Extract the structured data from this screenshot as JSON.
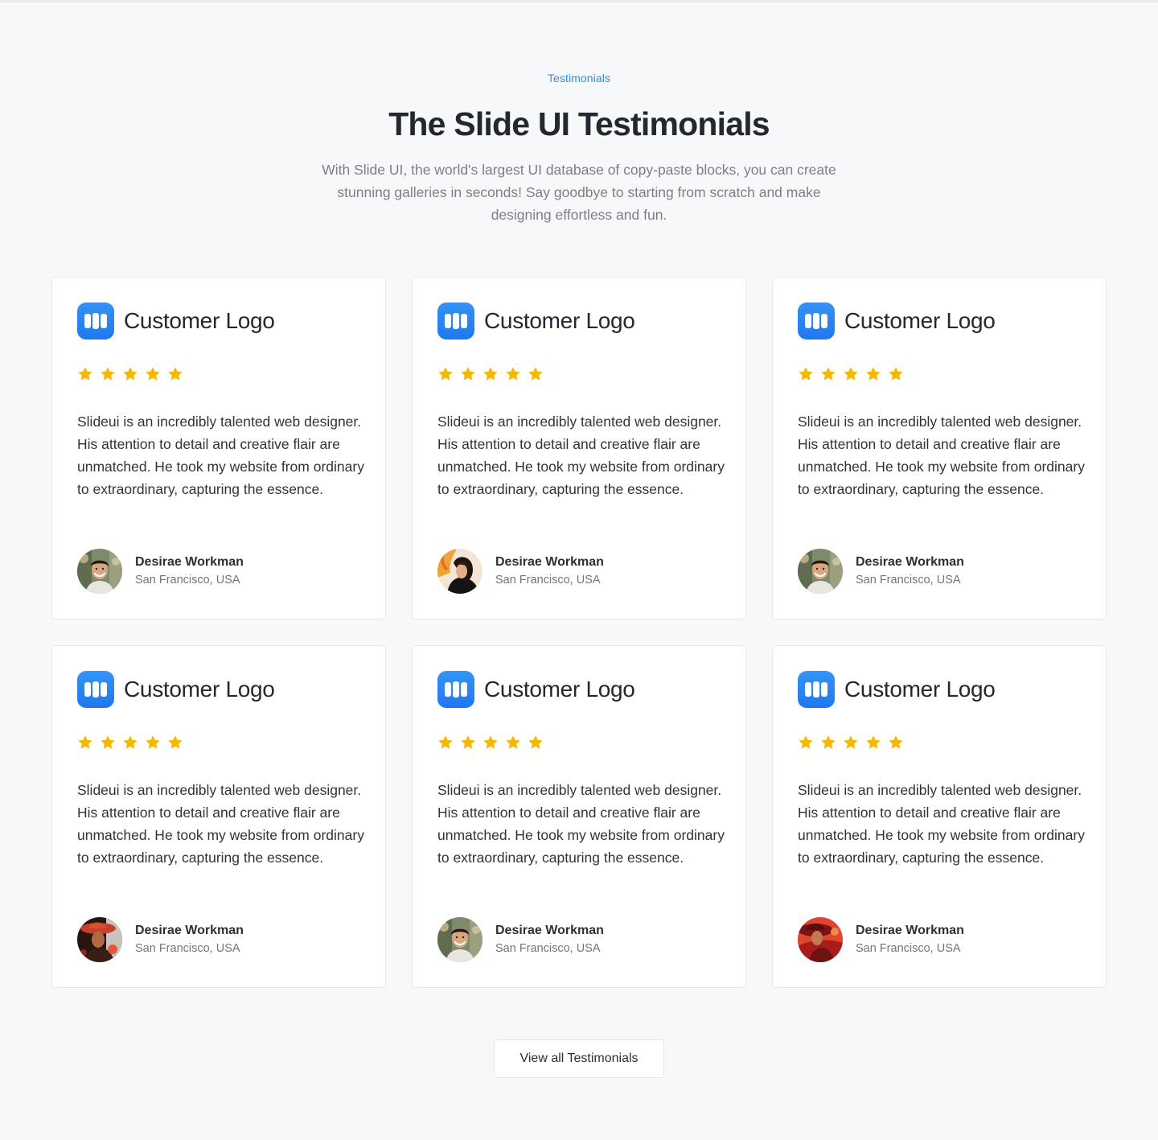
{
  "header": {
    "eyebrow": "Testimonials",
    "title": "The Slide UI Testimonials",
    "subtitle": "With Slide UI, the world's largest UI database of copy-paste blocks, you can create stunning galleries in seconds! Say goodbye to starting from scratch and make designing effortless and fun."
  },
  "colors": {
    "accent": "#2f8fe6",
    "logo": "#1f78ee",
    "star": "#f5b800",
    "background": "#f7f8fa"
  },
  "testimonials": [
    {
      "logo_text": "Customer Logo",
      "logo_icon": "customer-logo-icon",
      "rating": 5,
      "quote": "Slideui is an incredibly talented web designer. His attention to detail and creative flair are unmatched. He took my website from ordinary to extraordinary, capturing the essence.",
      "name": "Desirae Workman",
      "location": "San Francisco, USA",
      "avatar": "avatar-man-smiling"
    },
    {
      "logo_text": "Customer Logo",
      "logo_icon": "customer-logo-icon",
      "rating": 5,
      "quote": "Slideui is an incredibly talented web designer. His attention to detail and creative flair are unmatched. He took my website from ordinary to extraordinary, capturing the essence.",
      "name": "Desirae Workman",
      "location": "San Francisco, USA",
      "avatar": "avatar-woman-fire"
    },
    {
      "logo_text": "Customer Logo",
      "logo_icon": "customer-logo-icon",
      "rating": 5,
      "quote": "Slideui is an incredibly talented web designer. His attention to detail and creative flair are unmatched. He took my website from ordinary to extraordinary, capturing the essence.",
      "name": "Desirae Workman",
      "location": "San Francisco, USA",
      "avatar": "avatar-man-smiling"
    },
    {
      "logo_text": "Customer Logo",
      "logo_icon": "customer-logo-icon",
      "rating": 5,
      "quote": "Slideui is an incredibly talented web designer. His attention to detail and creative flair are unmatched. He took my website from ordinary to extraordinary, capturing the essence.",
      "name": "Desirae Workman",
      "location": "San Francisco, USA",
      "avatar": "avatar-woman-hat"
    },
    {
      "logo_text": "Customer Logo",
      "logo_icon": "customer-logo-icon",
      "rating": 5,
      "quote": "Slideui is an incredibly talented web designer. His attention to detail and creative flair are unmatched. He took my website from ordinary to extraordinary, capturing the essence.",
      "name": "Desirae Workman",
      "location": "San Francisco, USA",
      "avatar": "avatar-man-smiling"
    },
    {
      "logo_text": "Customer Logo",
      "logo_icon": "customer-logo-icon",
      "rating": 5,
      "quote": "Slideui is an incredibly talented web designer. His attention to detail and creative flair are unmatched. He took my website from ordinary to extraordinary, capturing the essence.",
      "name": "Desirae Workman",
      "location": "San Francisco, USA",
      "avatar": "avatar-woman-red"
    }
  ],
  "footer": {
    "view_all_label": "View all Testimonials"
  }
}
